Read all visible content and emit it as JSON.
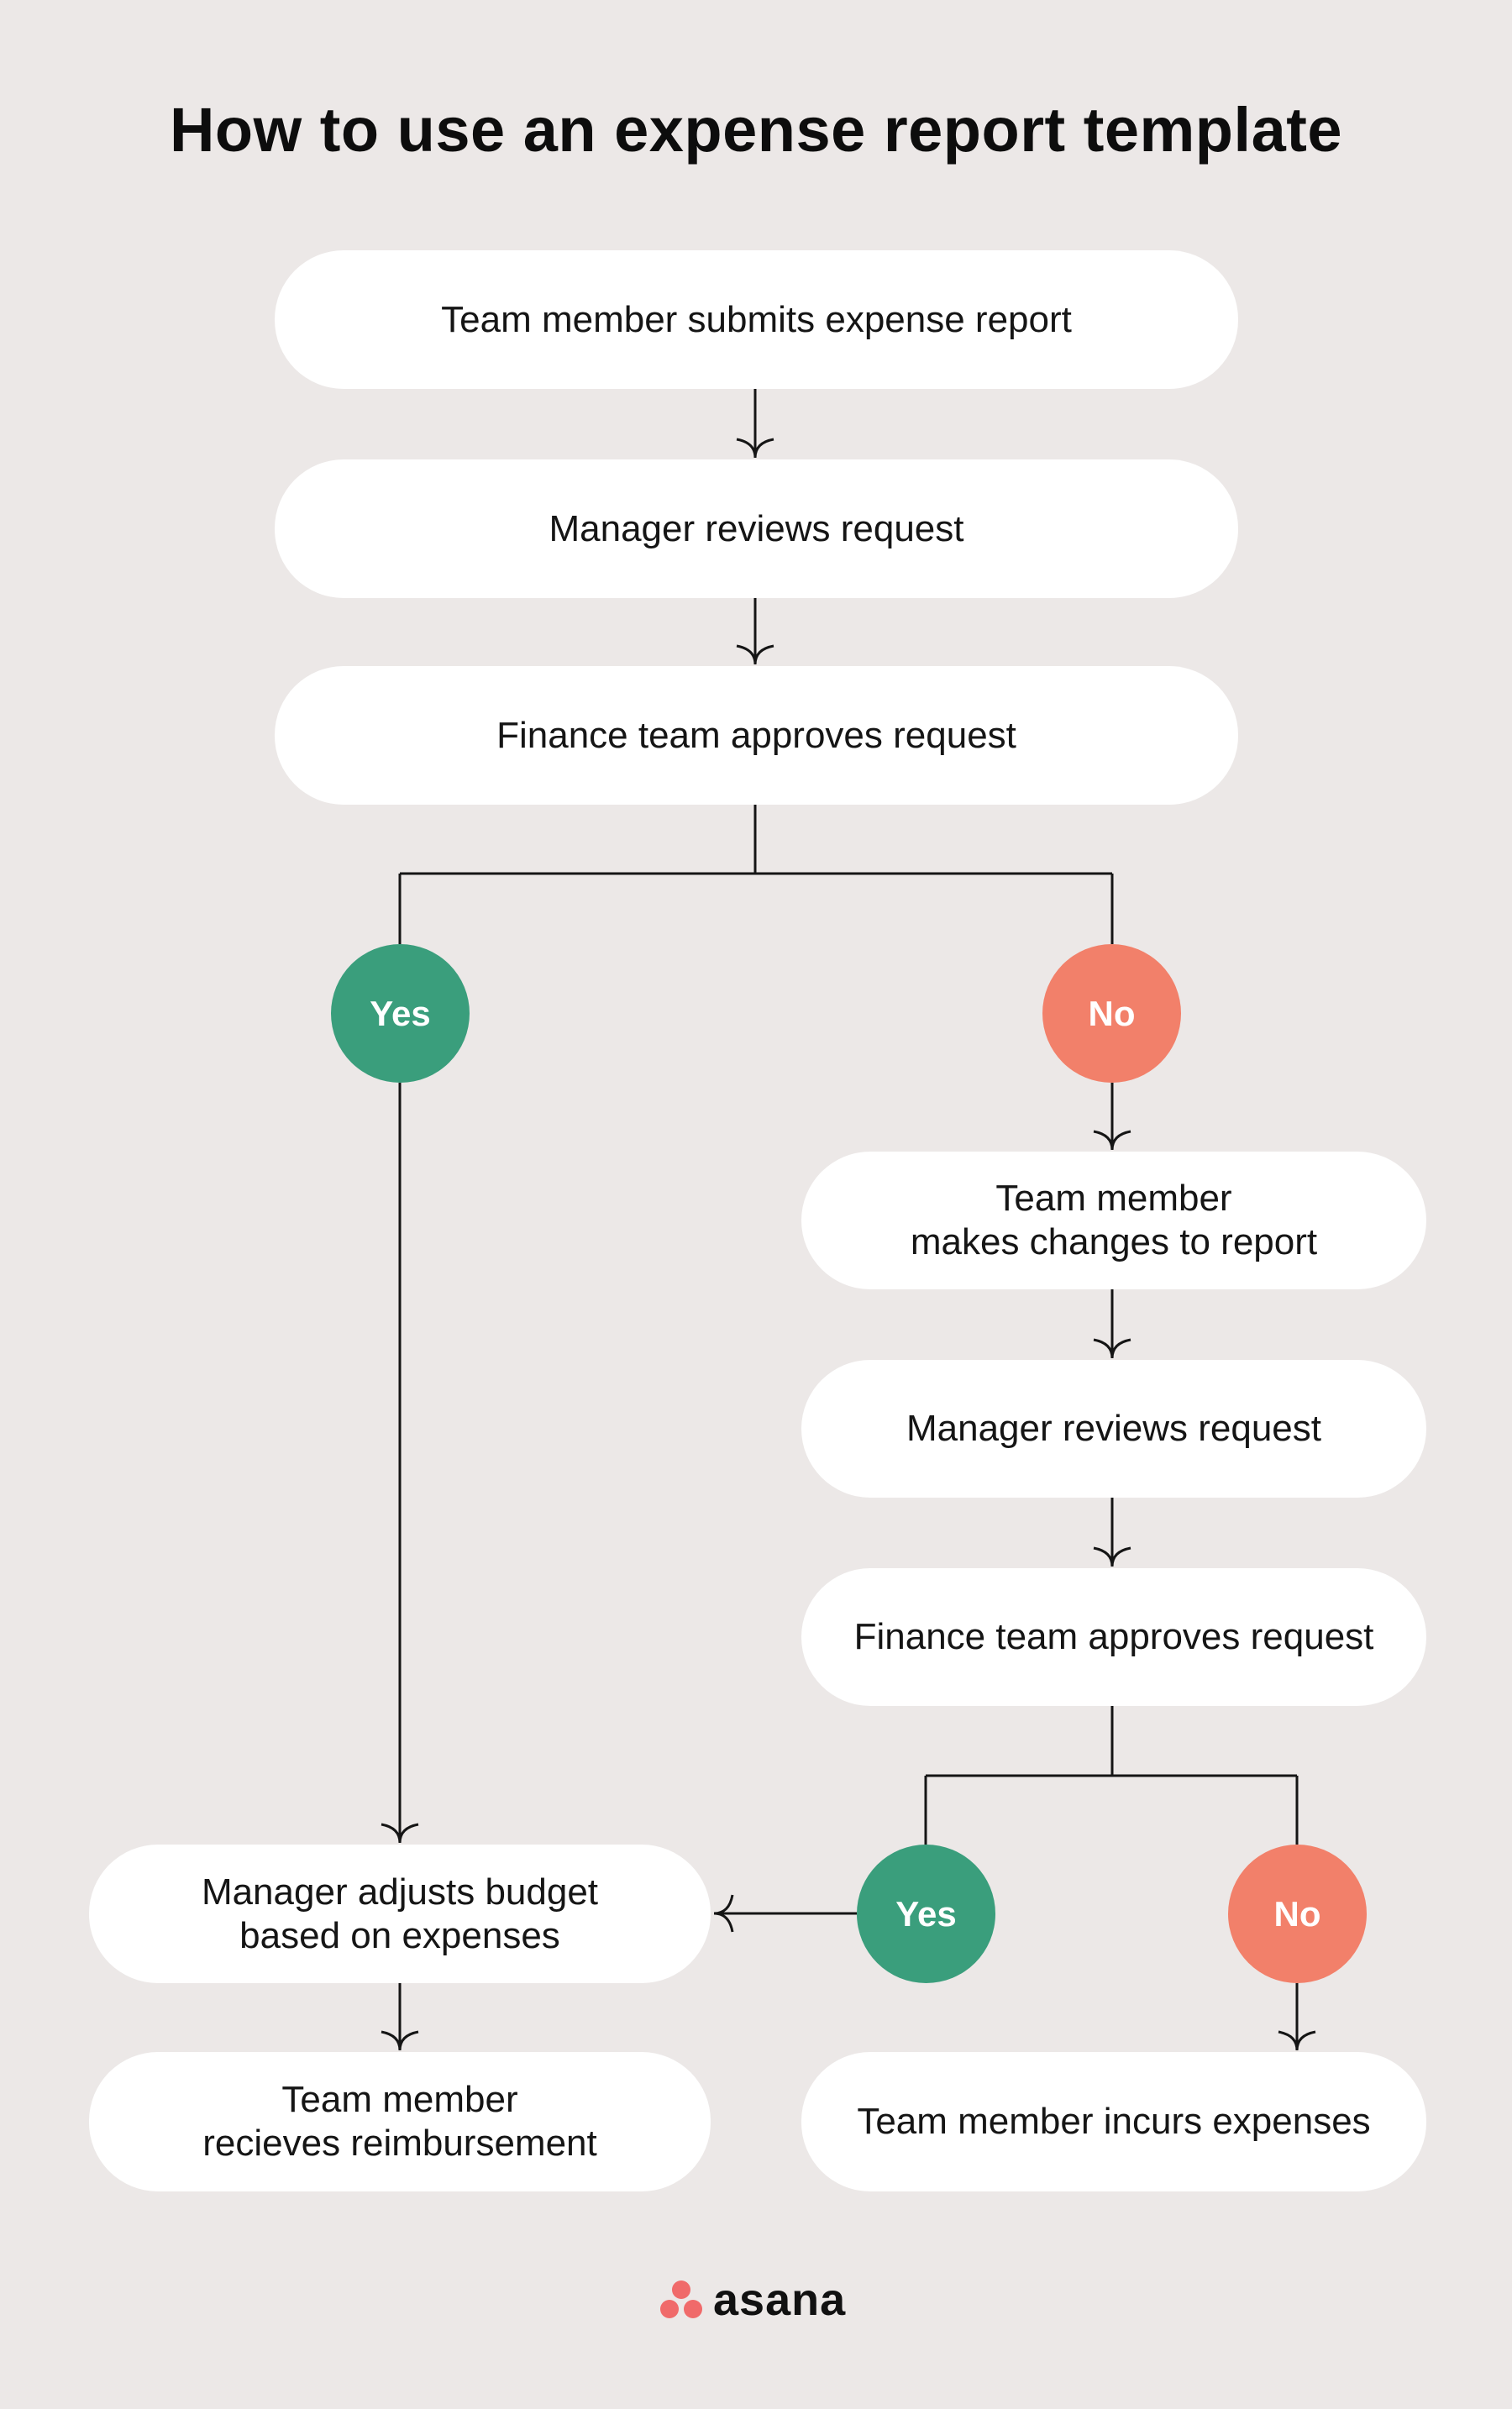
{
  "title": "How to use an expense report template",
  "colors": {
    "background": "#ece8e7",
    "box": "#ffffff",
    "yes": "#3a9e7c",
    "no": "#f2806a",
    "line": "#151515",
    "logo_dots": "#f06a6a"
  },
  "nodes": {
    "submit": "Team member submits expense report",
    "review1": "Manager reviews request",
    "approve1": "Finance team approves request",
    "decision1_yes": "Yes",
    "decision1_no": "No",
    "changes": "Team member\nmakes changes to report",
    "review2": "Manager reviews request",
    "approve2": "Finance team approves request",
    "decision2_yes": "Yes",
    "decision2_no": "No",
    "adjust_budget": "Manager adjusts budget\nbased on expenses",
    "reimbursement": "Team member\nrecieves reimbursement",
    "incurs": "Team member incurs expenses"
  },
  "edges": [
    {
      "from": "submit",
      "to": "review1"
    },
    {
      "from": "review1",
      "to": "approve1"
    },
    {
      "from": "approve1",
      "to": "decision1_yes"
    },
    {
      "from": "approve1",
      "to": "decision1_no"
    },
    {
      "from": "decision1_no",
      "to": "changes"
    },
    {
      "from": "changes",
      "to": "review2"
    },
    {
      "from": "review2",
      "to": "approve2"
    },
    {
      "from": "approve2",
      "to": "decision2_yes"
    },
    {
      "from": "approve2",
      "to": "decision2_no"
    },
    {
      "from": "decision1_yes",
      "to": "adjust_budget"
    },
    {
      "from": "decision2_yes",
      "to": "adjust_budget"
    },
    {
      "from": "adjust_budget",
      "to": "reimbursement"
    },
    {
      "from": "decision2_no",
      "to": "incurs"
    }
  ],
  "logo": {
    "wordmark": "asana",
    "icon": "asana-three-dots-icon"
  }
}
